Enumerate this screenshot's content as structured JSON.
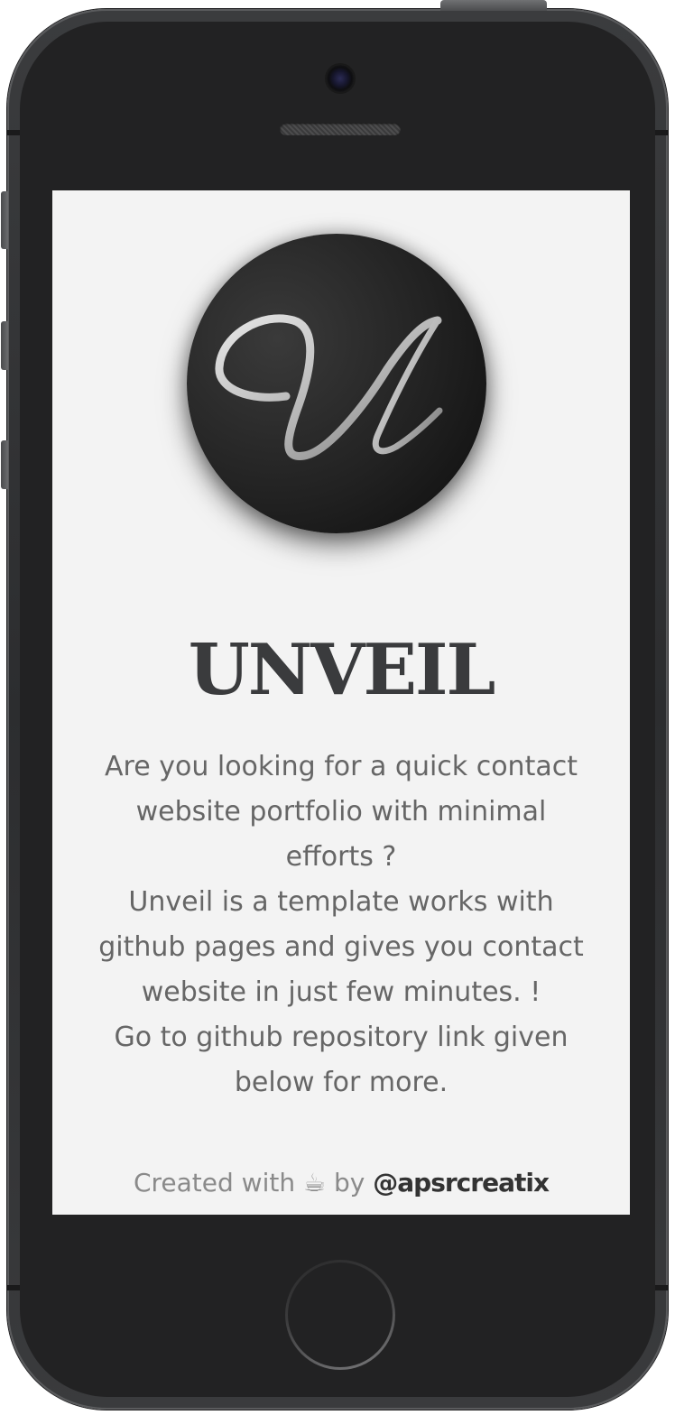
{
  "app": {
    "logo_letter": "U",
    "title": "UNVEIL",
    "description": [
      "Are you looking for a quick contact website portfolio with minimal efforts ?",
      "Unveil is a template works with github pages and gives you contact website in just few minutes. !",
      "Go to github repository link given below for more."
    ],
    "footer": {
      "prefix": "Created with",
      "icon": "coffee-icon",
      "icon_glyph": "☕",
      "by": "by",
      "author": "@apsrcreatix"
    }
  },
  "colors": {
    "screen_bg": "#f3f3f3",
    "title": "#3a3b3d",
    "text": "#666666",
    "author": "#333333",
    "phone_body": "#222223"
  }
}
